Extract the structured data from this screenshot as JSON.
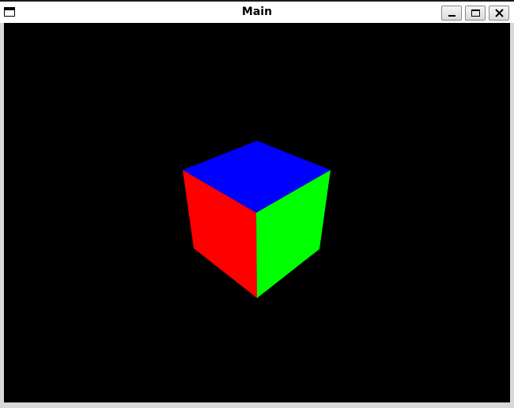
{
  "window": {
    "title": "Main",
    "controls": {
      "minimize_icon": "minimize-icon",
      "maximize_icon": "maximize-icon",
      "close_icon": "close-icon"
    }
  },
  "scene": {
    "background": "#000000",
    "cube": {
      "top_face_color": "#0000ff",
      "left_face_color": "#ff0000",
      "right_face_color": "#00ff00"
    }
  }
}
